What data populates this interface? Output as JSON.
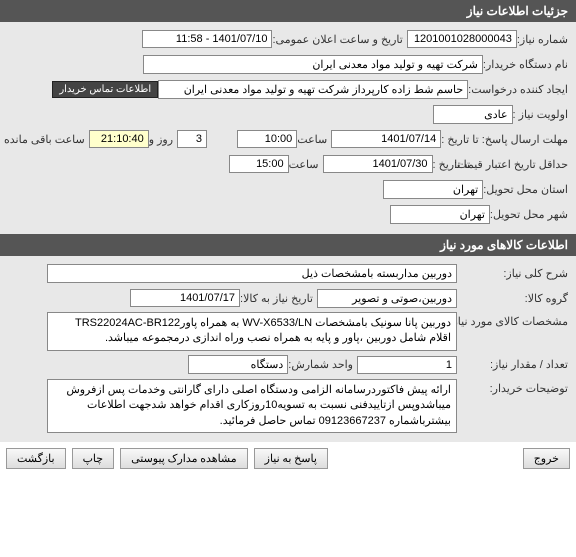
{
  "sections": {
    "need_details": {
      "title": "جزئیات اطلاعات نیاز"
    },
    "goods_info": {
      "title": "اطلاعات کالاهای مورد نیاز"
    }
  },
  "need_number": {
    "label": "شماره نیاز:",
    "value": "1201001028000043"
  },
  "public_announce": {
    "label": "تاریخ و ساعت اعلان عمومی:",
    "value": "1401/07/10 - 11:58"
  },
  "buyer_org": {
    "label": "نام دستگاه خریدار:",
    "value": "شرکت تهیه و تولید مواد معدنی ایران"
  },
  "request_creator": {
    "label": "ایجاد کننده درخواست:",
    "value": "حاسم شط زاده کارپرداز شرکت تهیه و تولید مواد معدنی ایران"
  },
  "buyer_contact_badge": "اطلاعات تماس خریدار",
  "priority": {
    "label": "اولویت نیاز :",
    "value": "عادی"
  },
  "response_deadline": {
    "label": "مهلت ارسال پاسخ:  تا تاریخ :",
    "date": "1401/07/14",
    "time_label": "ساعت",
    "time": "10:00"
  },
  "remaining": {
    "days_label": "روز و",
    "days": "3",
    "time": "21:10:40",
    "suffix": "ساعت باقی مانده"
  },
  "price_validity": {
    "label": "حداقل تاریخ اعتبار قیمت:",
    "to_label": "تا تاریخ :",
    "date": "1401/07/30",
    "time_label": "ساعت",
    "time": "15:00"
  },
  "delivery_province": {
    "label": "استان محل تحویل:",
    "value": "تهران"
  },
  "delivery_city": {
    "label": "شهر محل تحویل:",
    "value": "تهران"
  },
  "need_desc": {
    "label": "شرح کلی نیاز:",
    "value": "دوربین مداربسته بامشخصات ذیل"
  },
  "goods_group": {
    "label": "گروه کالا:",
    "value": "دوربین،صوتی و تصویر"
  },
  "need_date": {
    "label": "تاریخ نیاز به کالا:",
    "value": "1401/07/17"
  },
  "goods_spec": {
    "label": "مشخصات کالای مورد نیاز:",
    "value": "دوربین  پانا سونیک بامشخصات WV-X6533/LN به همراه پاورTRS22024AC-BR122 اقلام شامل دوربین ،پاور و پایه به همراه نصب وراه اندازی درمجموعه میباشد."
  },
  "qty": {
    "label": "تعداد / مقدار نیاز:",
    "value": "1"
  },
  "unit": {
    "label": "واحد شمارش:",
    "value": "دستگاه"
  },
  "buyer_notes": {
    "label": "توضیحات خریدار:",
    "value": "ارائه پیش فاکتوردرسامانه  الزامی ودستگاه اصلی دارای گارانتی وخدمات پس ازفروش میباشدوپس ازتاییدفنی نسبت به تسویه10روزکاری اقدام خواهد شدجهت اطلاعات بیشترباشماره 09123667237 تماس حاصل فرمائید."
  },
  "buttons": {
    "back": "بازگشت",
    "print": "چاپ",
    "attachments": "مشاهده مدارک پیوستی",
    "reply": "پاسخ به نیاز",
    "exit": "خروج"
  }
}
